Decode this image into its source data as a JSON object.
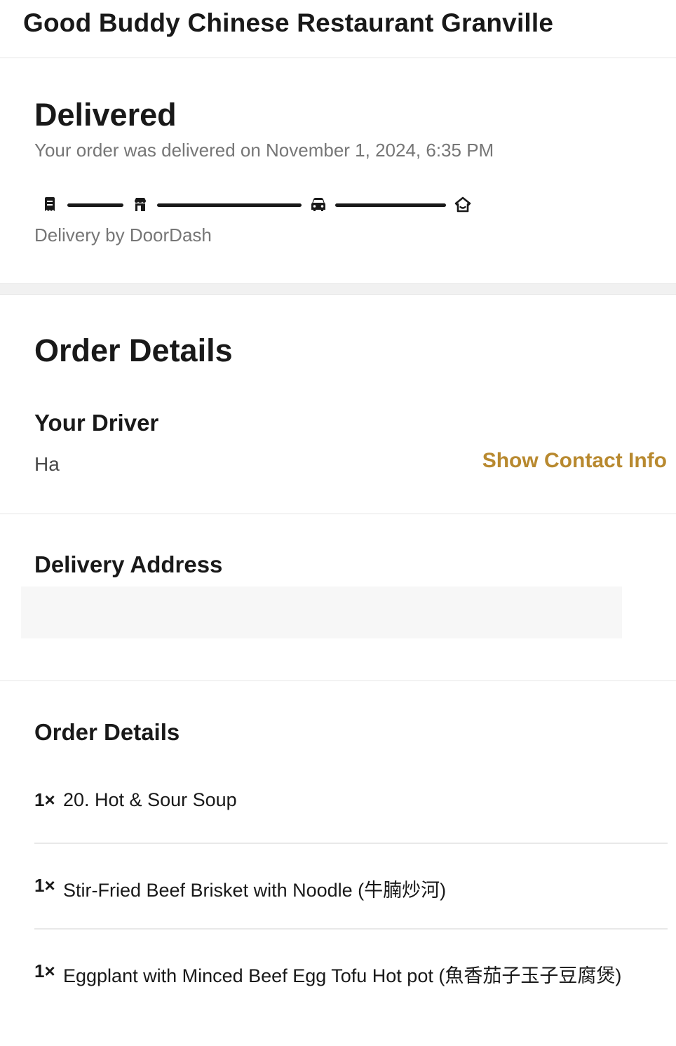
{
  "header": {
    "restaurant_name": "Good Buddy Chinese Restaurant Granville"
  },
  "status": {
    "title": "Delivered",
    "subtitle": "Your order was delivered on November 1, 2024, 6:35 PM",
    "delivery_by": "Delivery by DoorDash",
    "progress_steps": [
      "receipt-icon",
      "store-icon",
      "car-icon",
      "home-icon"
    ],
    "progress_complete": 1.0
  },
  "order_details": {
    "title": "Order Details",
    "driver": {
      "label": "Your Driver",
      "name": "Ha",
      "contact_label": "Show Contact Info"
    },
    "address": {
      "label": "Delivery Address",
      "value": ""
    },
    "items_label": "Order Details",
    "items": [
      {
        "qty": "1×",
        "name": "20. Hot & Sour Soup"
      },
      {
        "qty": "1×",
        "name": "Stir-Fried Beef Brisket with Noodle (牛腩炒河)"
      },
      {
        "qty": "1×",
        "name": "Eggplant with Minced Beef Egg Tofu Hot pot (魚香茄子玉子豆腐煲)"
      }
    ]
  },
  "colors": {
    "accent": "#b8892f",
    "text": "#191919",
    "muted": "#767676"
  }
}
